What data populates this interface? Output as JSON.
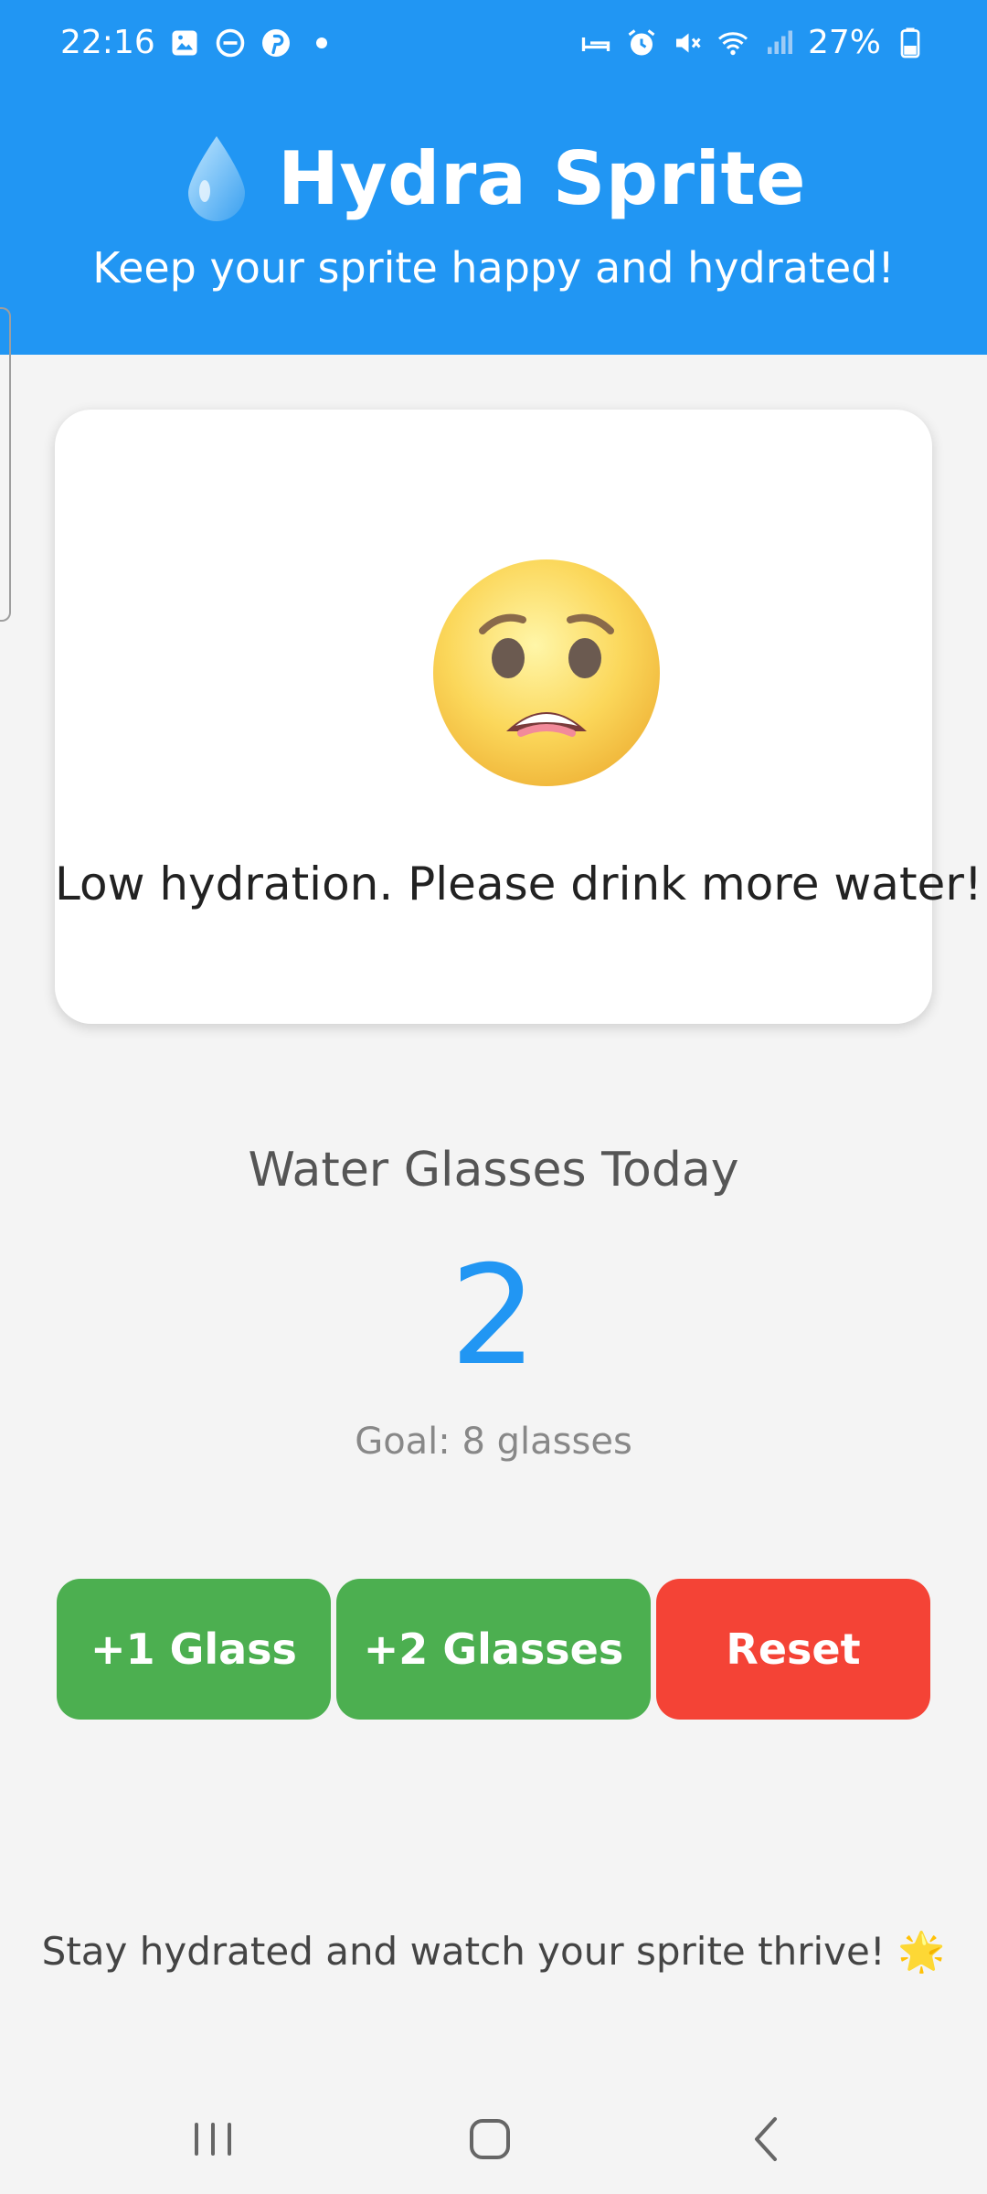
{
  "status_bar": {
    "time": "22:16",
    "battery": "27%",
    "left_icons": [
      "gallery-icon",
      "dnd-icon",
      "pinterest-icon",
      "dot-icon"
    ],
    "right_icons": [
      "sleep-icon",
      "alarm-icon",
      "mute-icon",
      "wifi-icon",
      "signal-icon",
      "battery-icon"
    ]
  },
  "header": {
    "icon": "water-drop-icon",
    "title": "Hydra Sprite",
    "subtitle": "Keep your sprite happy and hydrated!"
  },
  "sprite": {
    "mood_icon": "worried-face-icon",
    "message": "Low hydration. Please drink more water!"
  },
  "counter": {
    "label": "Water Glasses Today",
    "value": "2",
    "goal": "Goal: 8 glasses"
  },
  "actions": {
    "add_one": "+1 Glass",
    "add_two": "+2 Glasses",
    "reset": "Reset"
  },
  "footer": {
    "message": "Stay hydrated and watch your sprite thrive! 🌟"
  },
  "colors": {
    "primary": "#2196f3",
    "success": "#4caf50",
    "danger": "#f44336",
    "background": "#f4f4f4"
  },
  "nav_bar": {
    "icons": [
      "recents-icon",
      "home-icon",
      "back-icon"
    ]
  }
}
